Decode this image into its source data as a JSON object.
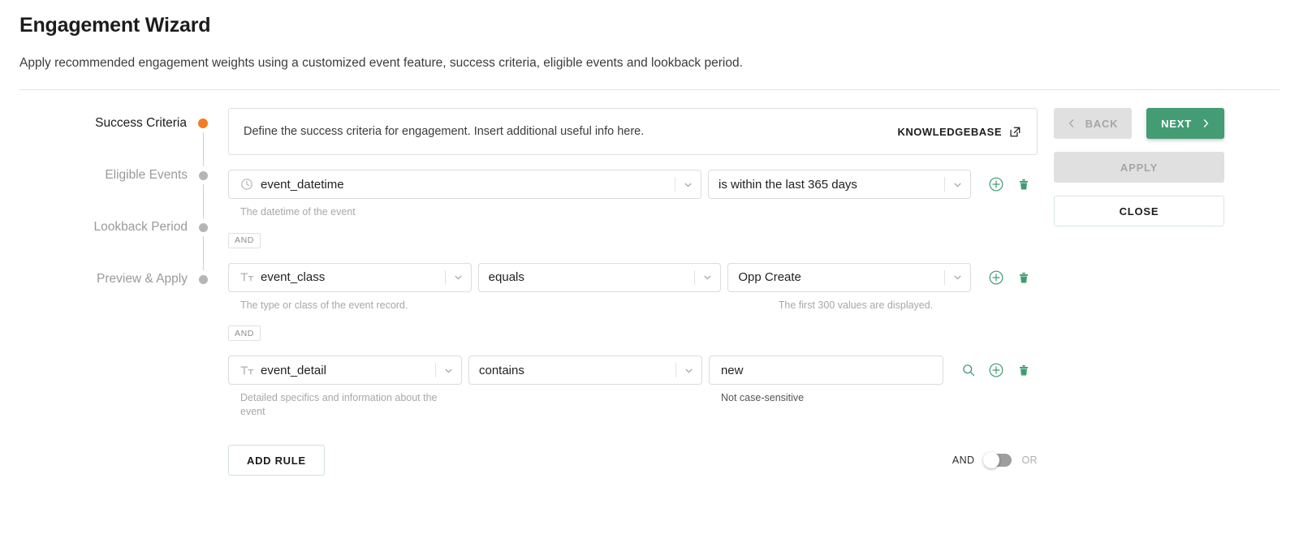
{
  "page": {
    "title": "Engagement Wizard",
    "subtitle": "Apply recommended engagement weights using a customized event feature, success criteria, eligible events and lookback period."
  },
  "stepper": {
    "steps": [
      {
        "label": "Success Criteria",
        "state": "active"
      },
      {
        "label": "Eligible Events",
        "state": "inactive"
      },
      {
        "label": "Lookback Period",
        "state": "inactive"
      },
      {
        "label": "Preview & Apply",
        "state": "inactive"
      }
    ]
  },
  "banner": {
    "text": "Define the success criteria for engagement. Insert additional useful info here.",
    "link_label": "KNOWLEDGEBASE",
    "link_icon": "external-link-icon"
  },
  "rules": [
    {
      "conjunction": null,
      "field": {
        "icon": "clock-icon",
        "value": "event_datetime"
      },
      "operator": {
        "value": "is within the last 365 days"
      },
      "value": null,
      "field_helper": "The datetime of the event",
      "value_helper": null,
      "has_search_icon": false
    },
    {
      "conjunction": "AND",
      "field": {
        "icon": "text-type-icon",
        "value": "event_class"
      },
      "operator": {
        "value": "equals"
      },
      "value": {
        "value": "Opp Create",
        "kind": "select"
      },
      "field_helper": "The type or class of the event record.",
      "value_helper": "The first 300 values are displayed.",
      "has_search_icon": false
    },
    {
      "conjunction": "AND",
      "field": {
        "icon": "text-type-icon",
        "value": "event_detail"
      },
      "operator": {
        "value": "contains"
      },
      "value": {
        "value": "new",
        "kind": "text"
      },
      "field_helper": "Detailed specifics and information about the event",
      "value_helper": "Not case-sensitive",
      "has_search_icon": true
    }
  ],
  "row_actions": {
    "add_icon": "plus-circle-icon",
    "delete_icon": "trash-icon",
    "search_icon": "search-icon"
  },
  "footer": {
    "add_rule_label": "ADD RULE",
    "conjunction_left": "AND",
    "conjunction_right": "OR",
    "conjunction_selected": "AND"
  },
  "actions": {
    "back_label": "BACK",
    "next_label": "NEXT",
    "apply_label": "APPLY",
    "close_label": "CLOSE",
    "back_icon": "chevron-left-icon",
    "next_icon": "chevron-right-icon"
  },
  "colors": {
    "accent_green": "#439c74",
    "active_step_orange": "#f47b20",
    "disabled_gray": "#e0e0e0"
  }
}
